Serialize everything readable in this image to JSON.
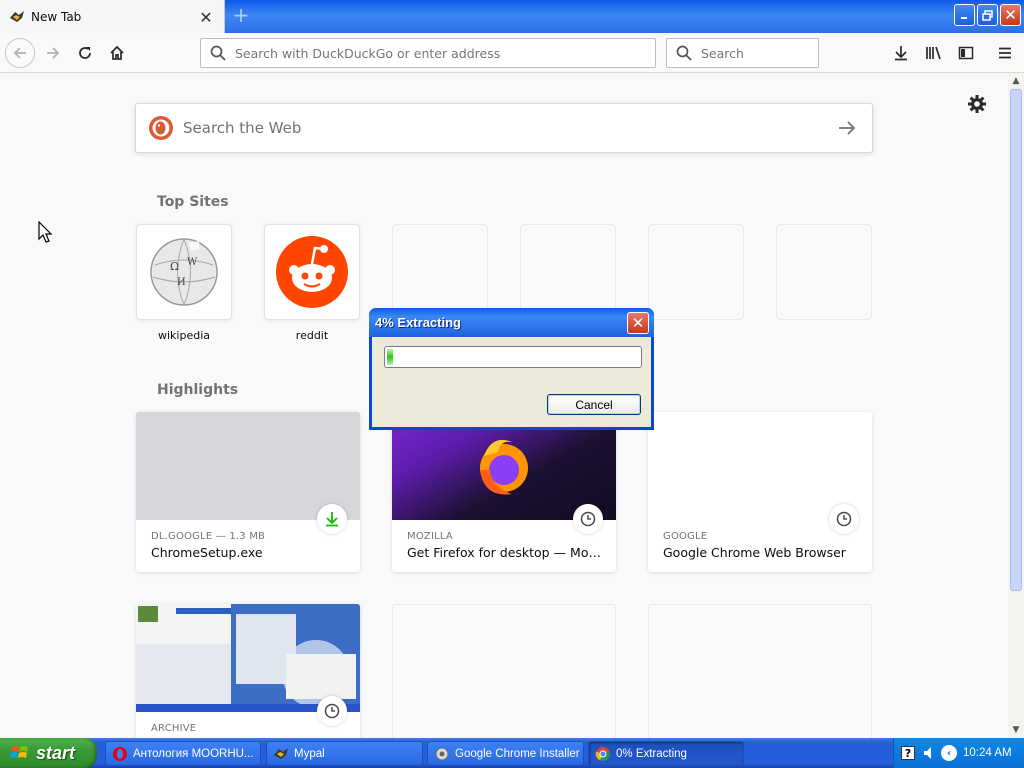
{
  "browser": {
    "tab_title": "New Tab",
    "new_tab_symbol": "+",
    "url_placeholder": "Search with DuckDuckGo or enter address",
    "search_placeholder": "Search",
    "window_controls": [
      "minimize-icon",
      "restore-icon",
      "close-icon"
    ]
  },
  "newtab": {
    "web_search_placeholder": "Search the Web",
    "top_sites_title": "Top Sites",
    "top_sites": [
      {
        "label": "wikipedia",
        "icon": "wikipedia-globe-icon"
      },
      {
        "label": "reddit",
        "icon": "reddit-alien-icon"
      },
      {
        "label": ""
      },
      {
        "label": ""
      },
      {
        "label": ""
      },
      {
        "label": ""
      }
    ],
    "highlights_title": "Highlights",
    "highlights": [
      {
        "source": "DL.GOOGLE — 1.3 MB",
        "title": "ChromeSetup.exe",
        "badge": "download-icon"
      },
      {
        "source": "MOZILLA",
        "title": "Get Firefox for desktop — Mozill...",
        "badge": "clock-icon"
      },
      {
        "source": "GOOGLE",
        "title": "Google Chrome Web Browser",
        "badge": "clock-icon"
      },
      {
        "source": "ARCHIVE",
        "title": "",
        "badge": "clock-icon"
      }
    ]
  },
  "dialog": {
    "title": "4% Extracting",
    "progress_percent": 4,
    "cancel_label": "Cancel"
  },
  "taskbar": {
    "start_label": "start",
    "tasks": [
      {
        "label": "Антология MOORHU...",
        "icon": "opera-icon"
      },
      {
        "label": "Mypal",
        "icon": "mypal-icon"
      },
      {
        "label": "Google Chrome Installer",
        "icon": "installer-icon"
      },
      {
        "label": "0% Extracting",
        "icon": "chrome-icon"
      }
    ],
    "clock": "10:24 AM"
  },
  "colors": {
    "xp_blue": "#245edb",
    "start_green": "#3a9a36",
    "reddit_orange": "#ff4500",
    "progress_green": "#2ec31e"
  }
}
